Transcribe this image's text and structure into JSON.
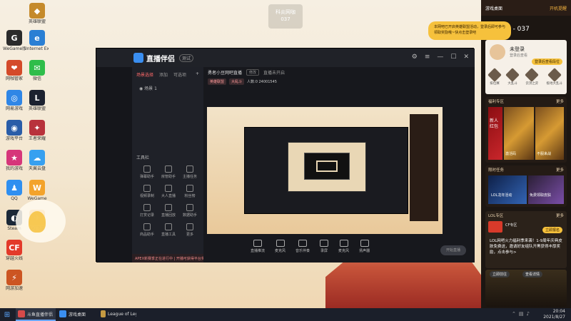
{
  "desktop": {
    "float_label_line1": "科炎网咖",
    "float_label_line2": "037",
    "icons": [
      {
        "label": "英雄联盟",
        "color": "#c58a2b",
        "glyph": "◆"
      },
      {
        "label": "WeGame版",
        "color": "#2b2b2b",
        "glyph": "G"
      },
      {
        "label": "Internet Explorer",
        "color": "#2a7fd4",
        "glyph": "e"
      },
      {
        "label": "网咖管家",
        "color": "#d44a2a",
        "glyph": "❤"
      },
      {
        "label": "微信",
        "color": "#2fbd4a",
        "glyph": "✉"
      },
      {
        "label": "网易游戏",
        "color": "#2f86e6",
        "glyph": "◎"
      },
      {
        "label": "英雄联盟",
        "color": "#1c2230",
        "glyph": "L"
      },
      {
        "label": "游戏平台",
        "color": "#2a5da8",
        "glyph": "◉"
      },
      {
        "label": "王者荣耀",
        "color": "#b8323c",
        "glyph": "✦"
      },
      {
        "label": "我的游戏",
        "color": "#d6367a",
        "glyph": "★"
      },
      {
        "label": "天翼云盘",
        "color": "#37a0f0",
        "glyph": "☁"
      },
      {
        "label": "QQ",
        "color": "#2f8ff0",
        "glyph": "♟"
      },
      {
        "label": "WeGame",
        "color": "#f3a32b",
        "glyph": "W"
      },
      {
        "label": "Steam",
        "color": "#1b2838",
        "glyph": "◐"
      },
      {
        "label": "QQ飞车",
        "color": "#f0a02b",
        "glyph": "✈"
      },
      {
        "label": "穿越火线",
        "color": "#e33a2a",
        "glyph": "CF"
      },
      {
        "label": "网游加速",
        "color": "#cc5522",
        "glyph": "⚡"
      }
    ]
  },
  "app": {
    "name": "直播伴侣",
    "badge": "测试",
    "tabs": [
      "场景选择",
      "添加",
      "可选项"
    ],
    "scene": "场景 1",
    "tools_title": "工具栏",
    "tools": [
      "弹幕助手",
      "房管助手",
      "主播任务",
      "视频录制",
      "大人直播",
      "粉丝榜",
      "打赏记录",
      "直播回放",
      "数据助手",
      "商品助手",
      "直播工具",
      "更多"
    ],
    "room_title": "勇者小豆网吧直播",
    "room_tag": "修改",
    "room_status": "直播未开启",
    "chip1": "英雄联盟",
    "chip2": "大乱斗",
    "stats": "人数:0    24001545",
    "bottom_tools": [
      "直播推流",
      "麦克风",
      "音乐伴奏",
      "录屏",
      "麦克风",
      "扬声器"
    ],
    "start_live": "开始直播",
    "notice": "APEX新赛季正在进行中 | 开播可获得平台奖励，每周可领取奖励"
  },
  "right_panel": {
    "top_title": "游戏桌面",
    "top_warn": "开机提醒",
    "pc_label": "PC - 037",
    "tooltip": "本网吧已开启英雄联盟活动，登录后即可参与领取奖励哦~快点击登录吧",
    "user_name": "未登录",
    "user_sub": "登录后查看",
    "login_btn": "登录后查看段位",
    "badges": [
      "排位赛",
      "大乱斗",
      "云顶之弈",
      "极地大乱斗"
    ],
    "section1_title": "福利专区",
    "section1_more": "更多",
    "section1_items": [
      "新人红包",
      "激活码",
      "不服来战"
    ],
    "section2_title": "限时任务",
    "section2_more": "更多",
    "section2_items": [
      "LOL龙年活动",
      "免费领取皮肤"
    ],
    "section3_title": "LOL专区",
    "section3_more": "更多",
    "cf_title": "CF专区",
    "cf_btn": "立即报名",
    "news_text": "LOL网吧火力福利季来袭！1-9周年庆典皮肤免费送，邀请好友组队开黑获得丰厚奖励，点击参与>",
    "news_btn1": "立即前往",
    "news_btn2": "查看详情"
  },
  "taskbar": {
    "items": [
      {
        "label": "斗鱼直播伴侣",
        "color": "#d64a4a",
        "active": true
      },
      {
        "label": "游戏桌面",
        "color": "#3a8ef0",
        "active": false
      },
      {
        "label": "League of Legends",
        "color": "#c59a42",
        "active": false
      }
    ],
    "time": "20:04",
    "date": "2021/8/27"
  }
}
